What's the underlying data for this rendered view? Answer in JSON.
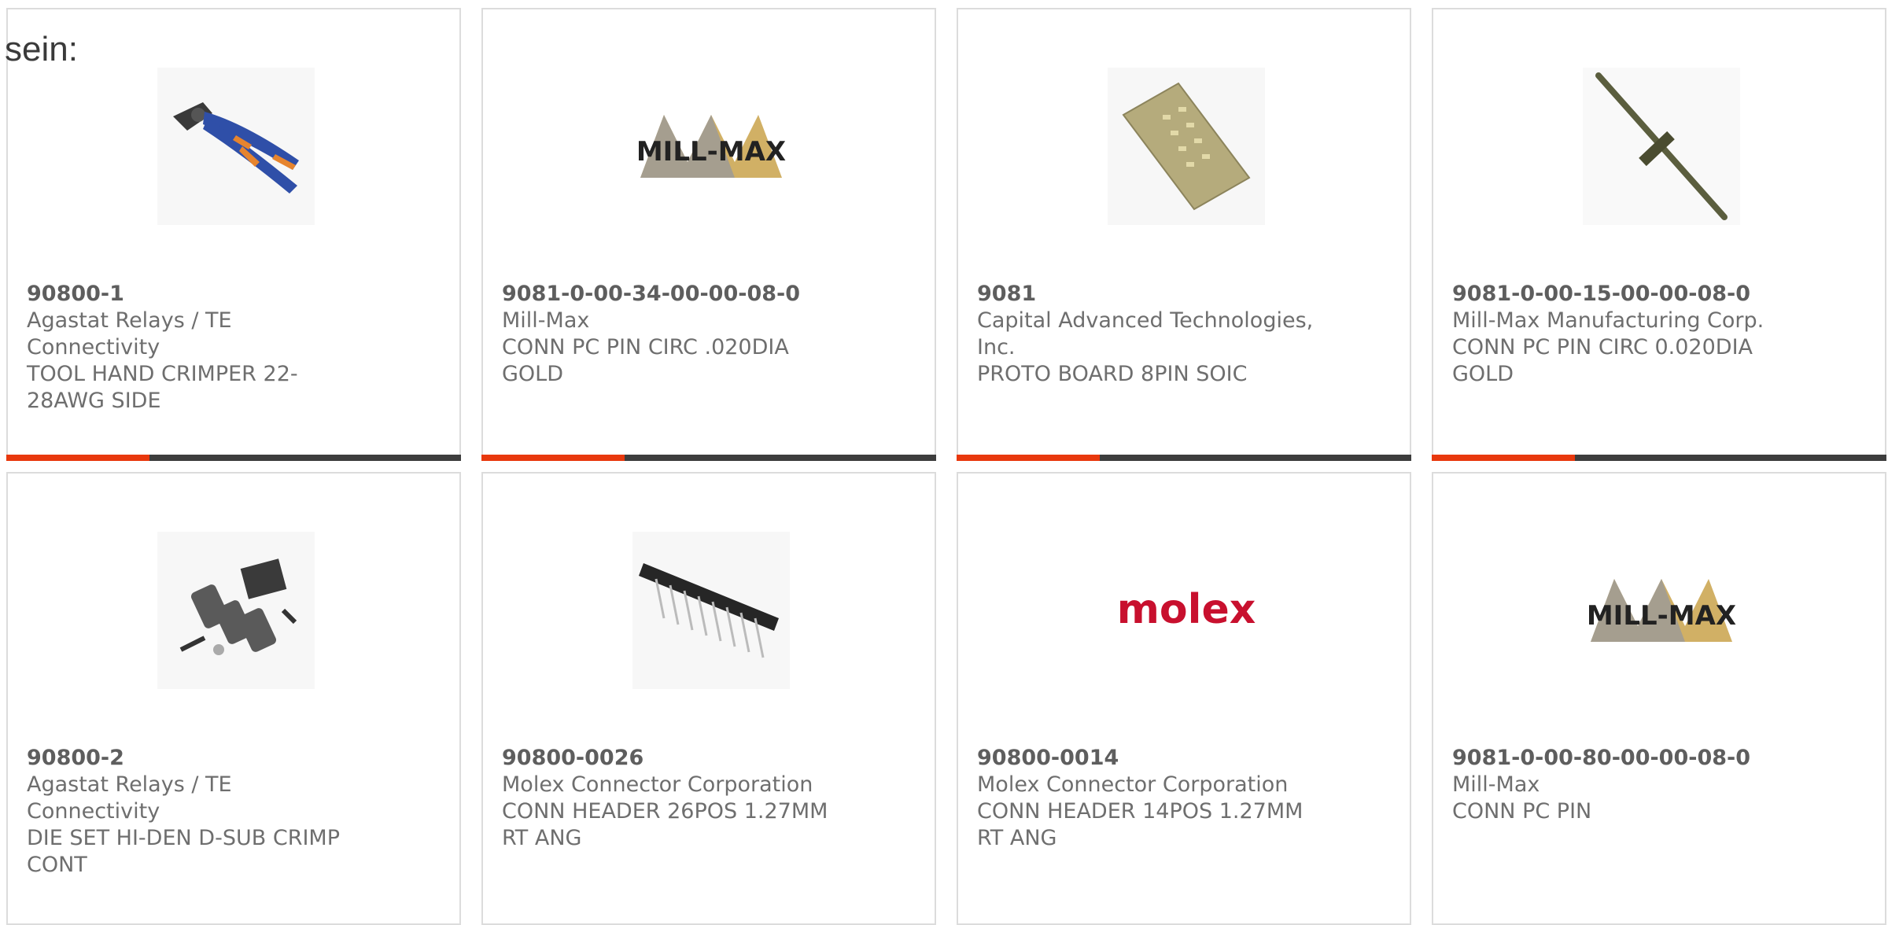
{
  "heading": "sein:",
  "colors": {
    "accent": "#e8380d",
    "bar": "#3d3d3d",
    "border": "#dcdcdc"
  },
  "products": [
    {
      "part_number": "90800-1",
      "manufacturer": "Agastat Relays / TE Connectivity",
      "description": "TOOL HAND CRIMPER 22-28AWG SIDE",
      "image": "crimper-tool-image"
    },
    {
      "part_number": "9081-0-00-34-00-00-08-0",
      "manufacturer": "Mill-Max",
      "description": "CONN PC PIN CIRC .020DIA GOLD",
      "image": "mill-max-logo"
    },
    {
      "part_number": "9081",
      "manufacturer": "Capital Advanced Technologies, Inc.",
      "description": "PROTO BOARD 8PIN SOIC",
      "image": "proto-board-image"
    },
    {
      "part_number": "9081-0-00-15-00-00-08-0",
      "manufacturer": "Mill-Max Manufacturing Corp.",
      "description": "CONN PC PIN CIRC 0.020DIA GOLD",
      "image": "pc-pin-image"
    },
    {
      "part_number": "90800-2",
      "manufacturer": "Agastat Relays / TE Connectivity",
      "description": "DIE SET HI-DEN D-SUB CRIMP CONT",
      "image": "die-set-image"
    },
    {
      "part_number": "90800-0026",
      "manufacturer": "Molex Connector Corporation",
      "description": "CONN HEADER 26POS 1.27MM RT ANG",
      "image": "header-connector-image"
    },
    {
      "part_number": "90800-0014",
      "manufacturer": "Molex Connector Corporation",
      "description": "CONN HEADER 14POS 1.27MM RT ANG",
      "image": "molex-logo"
    },
    {
      "part_number": "9081-0-00-80-00-00-08-0",
      "manufacturer": "Mill-Max",
      "description": "CONN PC PIN",
      "image": "mill-max-logo"
    }
  ],
  "logos": {
    "mill_max": "MILL-MAX",
    "molex": "molex"
  }
}
